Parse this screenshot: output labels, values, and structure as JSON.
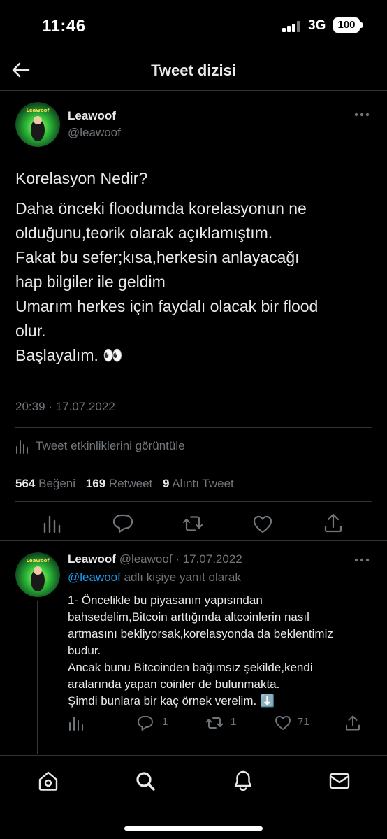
{
  "status_bar": {
    "time": "11:46",
    "network": "3G",
    "battery": "100"
  },
  "header": {
    "title": "Tweet dizisi"
  },
  "main_tweet": {
    "author_name": "Leawoof",
    "author_handle": "@leawoof",
    "avatar_text": "Leawoof",
    "title_line": "Korelasyon Nedir?",
    "body_lines": [
      "Daha önceki floodumda korelasyonun ne",
      "olduğunu,teorik olarak açıklamıştım.",
      "Fakat bu sefer;kısa,herkesin anlayacağı",
      "hap bilgiler ile geldim",
      "Umarım herkes için faydalı olacak bir flood",
      "olur.",
      "Başlayalım. 👀"
    ],
    "timestamp": "20:39 · 17.07.2022",
    "activity_label": "Tweet etkinliklerini görüntüle",
    "likes_count": "564",
    "likes_label": "Beğeni",
    "retweets_count": "169",
    "retweets_label": "Retweet",
    "quotes_count": "9",
    "quotes_label": "Alıntı Tweet"
  },
  "reply_tweet": {
    "author_name": "Leawoof",
    "author_handle": "@leawoof",
    "date": "· 17.07.2022",
    "reply_to_mention": "@leawoof",
    "reply_to_text": "adlı kişiye yanıt olarak",
    "body_lines": [
      "1- Öncelikle bu piyasanın yapısından",
      "bahsedelim,Bitcoin arttığında altcoinlerin nasıl",
      "artmasını bekliyorsak,korelasyonda da beklentimiz",
      "budur.",
      "Ancak bunu Bitcoinden bağımsız şekilde,kendi",
      "aralarında yapan coinler de bulunmakta.",
      "Şimdi bunlara bir kaç örnek verelim. ⬇️"
    ],
    "reply_count": "1",
    "retweet_count": "1",
    "like_count": "71"
  },
  "colors": {
    "accent": "#1d9bf0",
    "muted": "#71767b",
    "text": "#e7e9ea",
    "divider": "#2f3336",
    "background": "#000000"
  },
  "icons": {
    "back": "arrow-left-icon",
    "more": "more-dots-icon",
    "stats": "bar-chart-icon",
    "reply": "speech-bubble-icon",
    "retweet": "retweet-arrows-icon",
    "like": "heart-icon",
    "share": "share-upload-icon",
    "tabs": [
      "home-icon",
      "search-icon",
      "notifications-bell-icon",
      "messages-envelope-icon"
    ]
  }
}
